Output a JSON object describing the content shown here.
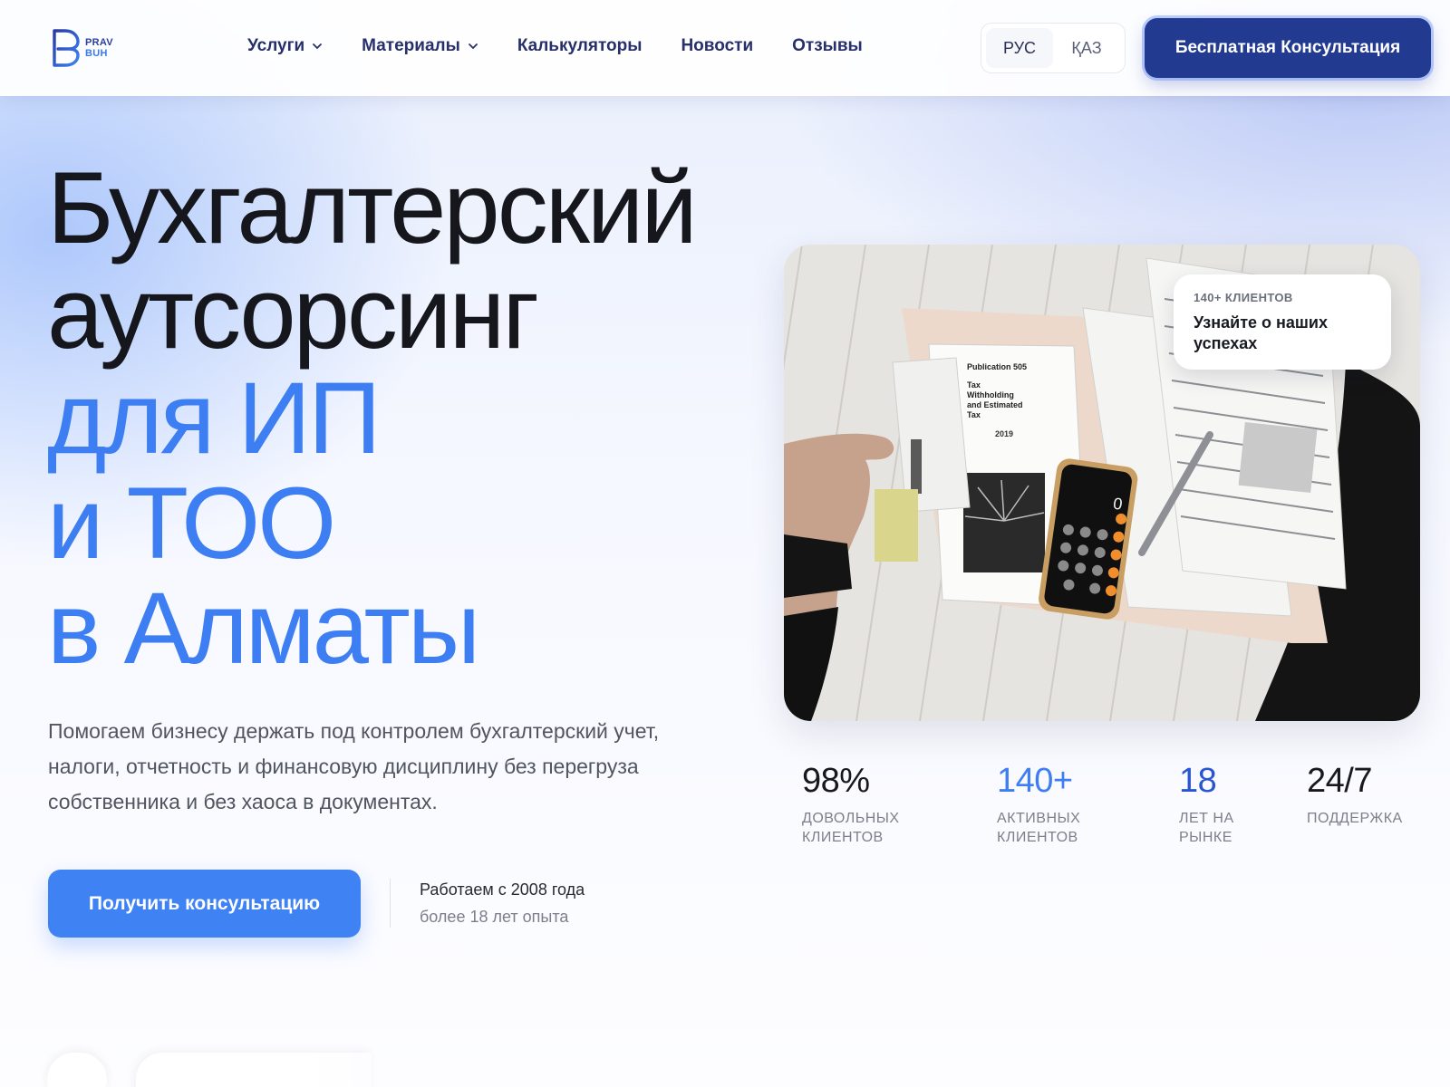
{
  "logo": {
    "line1": "PRAV",
    "line2": "BUH"
  },
  "nav": {
    "items": [
      {
        "label": "Услуги",
        "dropdown": true
      },
      {
        "label": "Материалы",
        "dropdown": true
      },
      {
        "label": "Калькуляторы",
        "dropdown": false
      },
      {
        "label": "Новости",
        "dropdown": false
      },
      {
        "label": "Отзывы",
        "dropdown": false
      }
    ]
  },
  "lang": {
    "options": [
      "РУС",
      "ҚАЗ"
    ],
    "active": "РУС"
  },
  "header_cta": "Бесплатная Консультация",
  "hero": {
    "title_dark": [
      "Бухгалтерский",
      "аутсорсинг"
    ],
    "title_blue": [
      "для ИП",
      "и ТОО",
      "в Алматы"
    ],
    "subtitle": "Помогаем бизнесу держать под контролем бухгалтерский учет, налоги, отчетность и финансовую дисциплину без перегруза собственника и без хаоса в документах.",
    "cta": "Получить консультацию",
    "since_title": "Работаем с 2008 года",
    "since_sub": "более 18 лет опыта"
  },
  "badge": {
    "small": "140+ КЛИЕНТОВ",
    "big": "Узнайте о наших успехах"
  },
  "stats": [
    {
      "value": "98%",
      "label": "ДОВОЛЬНЫХ КЛИЕНТОВ"
    },
    {
      "value": "140+",
      "label": "АКТИВНЫХ КЛИЕНТОВ"
    },
    {
      "value": "18",
      "label": "ЛЕТ НА РЫНКЕ"
    },
    {
      "value": "24/7",
      "label": "ПОДДЕРЖКА"
    }
  ],
  "photo": {
    "form_title": "Tax Withholding and Estimated Tax",
    "form_year": "2019",
    "form_pub": "Publication 505"
  },
  "colors": {
    "accent": "#3d7ef2",
    "navy": "#223a90",
    "text": "#15171c"
  }
}
